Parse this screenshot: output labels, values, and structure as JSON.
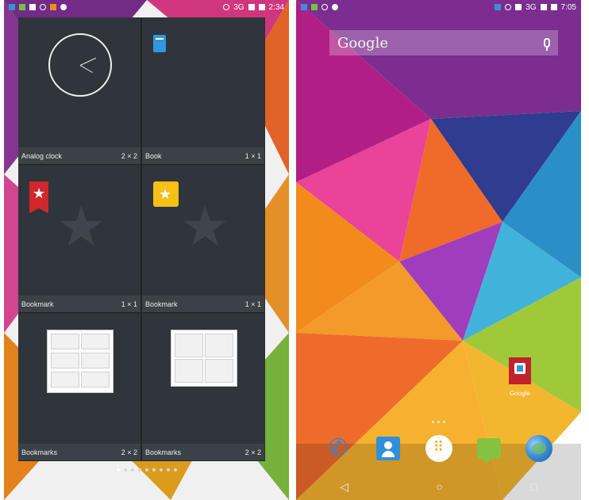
{
  "left_screen": {
    "status": {
      "network": "3G",
      "time": "2:34"
    },
    "widgets": [
      {
        "name": "Analog clock",
        "size": "2 × 2"
      },
      {
        "name": "Book",
        "size": "1 × 1"
      },
      {
        "name": "Bookmark",
        "size": "1 × 1"
      },
      {
        "name": "Bookmark",
        "size": "1 × 1"
      },
      {
        "name": "Bookmarks",
        "size": "2 × 2"
      },
      {
        "name": "Bookmarks",
        "size": "2 × 2"
      }
    ],
    "page_indicator": {
      "pages": 9,
      "current": 1
    },
    "nav": {
      "back": "◁",
      "home": "○",
      "recents": "□"
    }
  },
  "right_screen": {
    "status": {
      "network": "3G",
      "time": "7:05"
    },
    "search_bar": {
      "placeholder": "Google"
    },
    "home_app": {
      "label": "Google"
    },
    "dock_apps": [
      "phone-icon",
      "contacts-icon",
      "apps-icon",
      "messaging-icon",
      "browser-icon"
    ],
    "nav": {
      "back": "◁",
      "home": "○",
      "recents": "□"
    }
  },
  "colors": {
    "widget_bg": "#2f353a",
    "widget_label_bg": "#3b4146",
    "accent_blue": "#3196dd",
    "bookmark_red": "#d1272d",
    "bookmark_yellow": "#f6c015"
  }
}
